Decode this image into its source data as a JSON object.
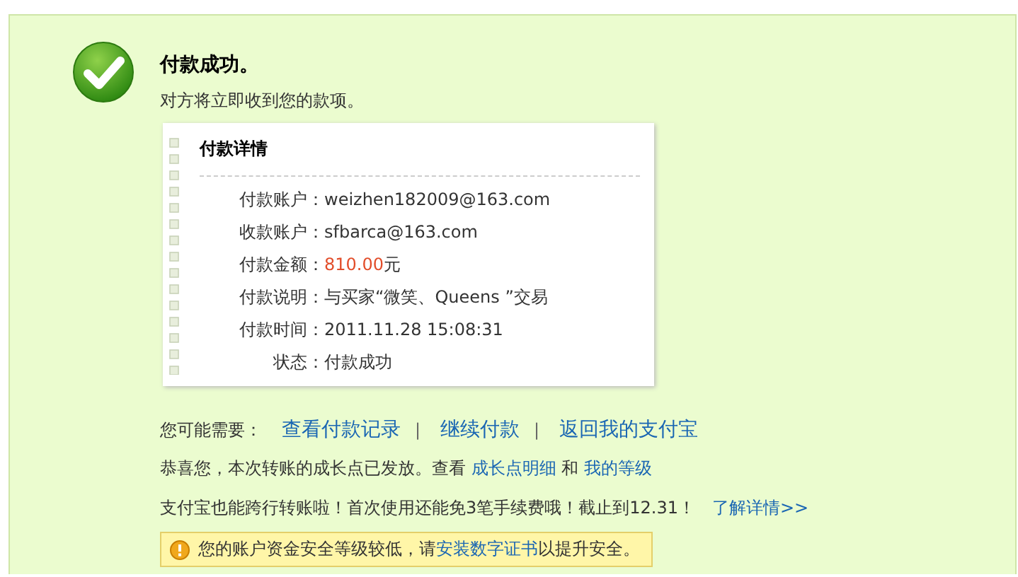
{
  "status": {
    "title": "付款成功。",
    "subtitle": "对方将立即收到您的款项。"
  },
  "details": {
    "title": "付款详情",
    "rows": [
      {
        "kind": "text",
        "label": "付款账户：",
        "value": "weizhen182009@163.com"
      },
      {
        "kind": "text",
        "label": "收款账户：",
        "value": "sfbarca@163.com"
      },
      {
        "kind": "amount",
        "label": "付款金额：",
        "value": "810.00",
        "unit": "元"
      },
      {
        "kind": "text",
        "label": "付款说明：",
        "value": "与买家“微笑、Queens ”交易"
      },
      {
        "kind": "text",
        "label": "付款时间：",
        "value": "2011.11.28 15:08:31"
      },
      {
        "kind": "text",
        "label": "状态：",
        "value": "付款成功"
      }
    ]
  },
  "quick_links": {
    "label": "您可能需要：",
    "links": [
      "查看付款记录",
      "继续付款",
      "返回我的支付宝"
    ],
    "separator": "|"
  },
  "growth_notice": [
    {
      "kind": "text",
      "text": "恭喜您，本次转账的成长点已发放。查看 "
    },
    {
      "kind": "link",
      "text": "成长点明细"
    },
    {
      "kind": "text",
      "text": " 和 "
    },
    {
      "kind": "link",
      "text": "我的等级"
    }
  ],
  "promo": {
    "text": "支付宝也能跨行转账啦！首次使用还能免3笔手续费哦！截止到12.31！",
    "link": "了解详情>>"
  },
  "warning": [
    {
      "kind": "text",
      "text": "您的账户资金安全等级较低，请"
    },
    {
      "kind": "link",
      "text": "安装数字证书"
    },
    {
      "kind": "text",
      "text": "以提升安全。"
    }
  ]
}
